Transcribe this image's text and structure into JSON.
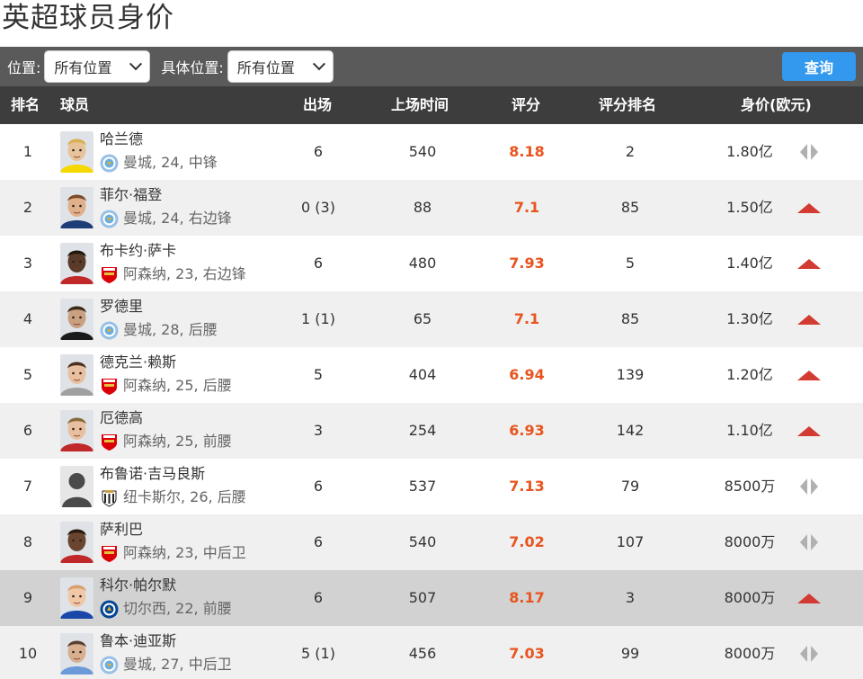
{
  "title": "英超球员身价",
  "filters": {
    "position_label": "位置:",
    "position_value": "所有位置",
    "detail_label": "具体位置:",
    "detail_value": "所有位置",
    "query_label": "查询"
  },
  "columns": {
    "rank": "排名",
    "player": "球员",
    "apps": "出场",
    "minutes": "上场时间",
    "rating": "评分",
    "rating_rank": "评分排名",
    "value": "身价(欧元)"
  },
  "colors": {
    "header_bg": "#3d3d3d",
    "filter_bg": "#5a5a5a",
    "accent_button": "#3399ee",
    "rating": "#e8541e",
    "trend_up": "#d23b32",
    "trend_flat": "#b0b0b0"
  },
  "players": [
    {
      "rank": "1",
      "name": "哈兰德",
      "club": "曼城",
      "info": "曼城, 24, 中锋",
      "apps": "6",
      "minutes": "540",
      "rating": "8.18",
      "rating_rank": "2",
      "value": "1.80亿",
      "trend": "flat"
    },
    {
      "rank": "2",
      "name": "菲尔·福登",
      "club": "曼城",
      "info": "曼城, 24, 右边锋",
      "apps": "0 (3)",
      "minutes": "88",
      "rating": "7.1",
      "rating_rank": "85",
      "value": "1.50亿",
      "trend": "up"
    },
    {
      "rank": "3",
      "name": "布卡约·萨卡",
      "club": "阿森纳",
      "info": "阿森纳, 23, 右边锋",
      "apps": "6",
      "minutes": "480",
      "rating": "7.93",
      "rating_rank": "5",
      "value": "1.40亿",
      "trend": "up"
    },
    {
      "rank": "4",
      "name": "罗德里",
      "club": "曼城",
      "info": "曼城, 28, 后腰",
      "apps": "1 (1)",
      "minutes": "65",
      "rating": "7.1",
      "rating_rank": "85",
      "value": "1.30亿",
      "trend": "up"
    },
    {
      "rank": "5",
      "name": "德克兰·赖斯",
      "club": "阿森纳",
      "info": "阿森纳, 25, 后腰",
      "apps": "5",
      "minutes": "404",
      "rating": "6.94",
      "rating_rank": "139",
      "value": "1.20亿",
      "trend": "up"
    },
    {
      "rank": "6",
      "name": "厄德高",
      "club": "阿森纳",
      "info": "阿森纳, 25, 前腰",
      "apps": "3",
      "minutes": "254",
      "rating": "6.93",
      "rating_rank": "142",
      "value": "1.10亿",
      "trend": "up"
    },
    {
      "rank": "7",
      "name": "布鲁诺·吉马良斯",
      "club": "纽卡斯尔",
      "info": "纽卡斯尔, 26, 后腰",
      "apps": "6",
      "minutes": "537",
      "rating": "7.13",
      "rating_rank": "79",
      "value": "8500万",
      "trend": "flat"
    },
    {
      "rank": "8",
      "name": "萨利巴",
      "club": "阿森纳",
      "info": "阿森纳, 23, 中后卫",
      "apps": "6",
      "minutes": "540",
      "rating": "7.02",
      "rating_rank": "107",
      "value": "8000万",
      "trend": "flat"
    },
    {
      "rank": "9",
      "name": "科尔·帕尔默",
      "club": "切尔西",
      "info": "切尔西, 22, 前腰",
      "apps": "6",
      "minutes": "507",
      "rating": "8.17",
      "rating_rank": "3",
      "value": "8000万",
      "trend": "up"
    },
    {
      "rank": "10",
      "name": "鲁本·迪亚斯",
      "club": "曼城",
      "info": "曼城, 27, 中后卫",
      "apps": "5 (1)",
      "minutes": "456",
      "rating": "7.03",
      "rating_rank": "99",
      "value": "8000万",
      "trend": "flat"
    }
  ]
}
